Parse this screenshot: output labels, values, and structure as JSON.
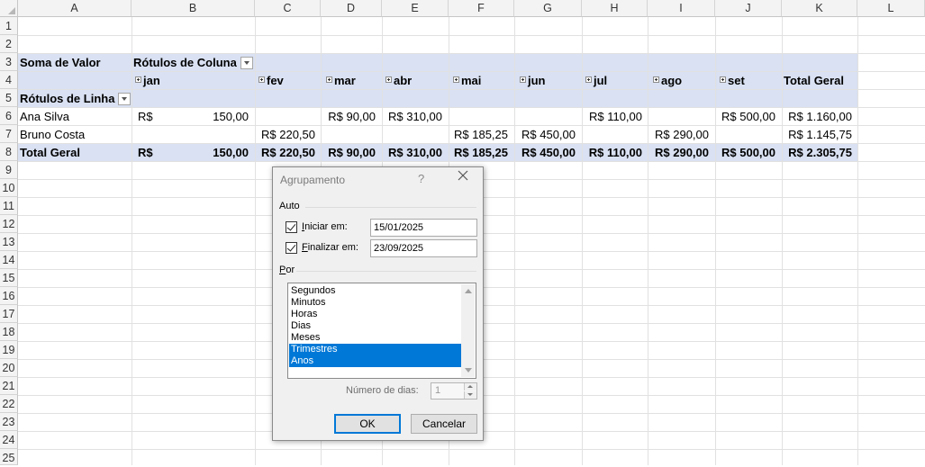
{
  "columns": [
    "A",
    "B",
    "C",
    "D",
    "E",
    "F",
    "G",
    "H",
    "I",
    "J",
    "K",
    "L"
  ],
  "rows": [
    "1",
    "2",
    "3",
    "4",
    "5",
    "6",
    "7",
    "8",
    "9",
    "10",
    "11",
    "12",
    "13",
    "14",
    "15",
    "16",
    "17",
    "18",
    "19",
    "20",
    "21",
    "22",
    "23",
    "24",
    "25"
  ],
  "pivot": {
    "values_label": "Soma de Valor",
    "col_labels": "Rótulos de Coluna",
    "row_labels": "Rótulos de Linha",
    "months": [
      "jan",
      "fev",
      "mar",
      "abr",
      "mai",
      "jun",
      "jul",
      "ago",
      "set"
    ],
    "grand_total_header": "Total Geral",
    "currency": "R$",
    "ana": {
      "name": "Ana Silva",
      "jan_amount": "150,00",
      "mar": "R$ 90,00",
      "abr": "R$ 310,00",
      "jul": "R$ 110,00",
      "set": "R$ 500,00",
      "total": "R$ 1.160,00"
    },
    "bruno": {
      "name": "Bruno Costa",
      "fev": "R$ 220,50",
      "mai": "R$ 185,25",
      "jun": "R$ 450,00",
      "ago": "R$ 290,00",
      "total": "R$ 1.145,75"
    },
    "totals": {
      "label": "Total Geral",
      "jan_amount": "150,00",
      "fev": "R$ 220,50",
      "mar": "R$ 90,00",
      "abr": "R$ 310,00",
      "mai": "R$ 185,25",
      "jun": "R$ 450,00",
      "jul": "R$ 110,00",
      "ago": "R$ 290,00",
      "set": "R$ 500,00",
      "total": "R$ 2.305,75"
    }
  },
  "dialog": {
    "title": "Agrupamento",
    "help": "?",
    "auto_label": "Auto",
    "start_first": "I",
    "start_rest": "niciar em:",
    "start_value": "15/01/2025",
    "end_first": "F",
    "end_rest": "inalizar em:",
    "end_value": "23/09/2025",
    "by_first": "P",
    "by_rest": "or",
    "options": [
      "Segundos",
      "Minutos",
      "Horas",
      "Dias",
      "Meses",
      "Trimestres",
      "Anos"
    ],
    "days_label": "Número de dias:",
    "days_value": "1",
    "ok": "OK",
    "cancel": "Cancelar"
  }
}
